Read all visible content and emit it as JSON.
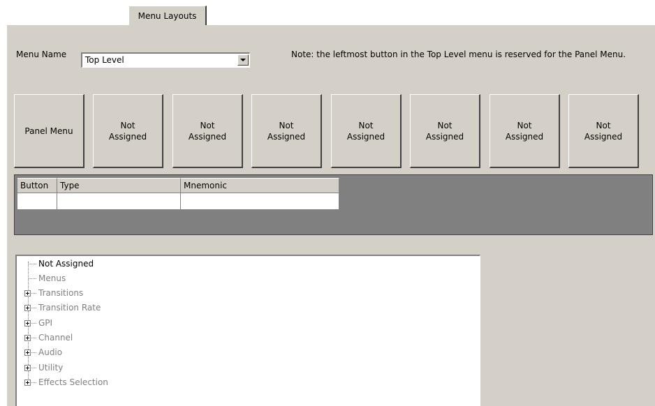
{
  "tabs": [
    {
      "label": "Menu Layouts"
    }
  ],
  "menu_name": {
    "label": "Menu Name",
    "selected": "Top Level",
    "note": "Note: the leftmost button in the Top Level menu is reserved for the Panel Menu."
  },
  "panel_buttons": [
    {
      "label": "Panel Menu"
    },
    {
      "label": "Not\nAssigned"
    },
    {
      "label": "Not\nAssigned"
    },
    {
      "label": "Not\nAssigned"
    },
    {
      "label": "Not\nAssigned"
    },
    {
      "label": "Not\nAssigned"
    },
    {
      "label": "Not\nAssigned"
    },
    {
      "label": "Not\nAssigned"
    }
  ],
  "grid": {
    "columns": [
      "Button",
      "Type",
      "Mnemonic"
    ],
    "rows": [
      [
        "",
        "",
        ""
      ]
    ]
  },
  "tree": {
    "items": [
      {
        "label": "Not Assigned",
        "expandable": false,
        "enabled": true
      },
      {
        "label": "Menus",
        "expandable": false,
        "enabled": false
      },
      {
        "label": "Transitions",
        "expandable": true,
        "enabled": false
      },
      {
        "label": "Transition Rate",
        "expandable": true,
        "enabled": false
      },
      {
        "label": "GPI",
        "expandable": true,
        "enabled": false
      },
      {
        "label": "Channel",
        "expandable": true,
        "enabled": false
      },
      {
        "label": "Audio",
        "expandable": true,
        "enabled": false
      },
      {
        "label": "Utility",
        "expandable": true,
        "enabled": false
      },
      {
        "label": "Effects Selection",
        "expandable": true,
        "enabled": false
      }
    ]
  },
  "colors": {
    "face": "#d4d0c8",
    "grid_background": "#808080",
    "disabled_text": "#808080"
  }
}
